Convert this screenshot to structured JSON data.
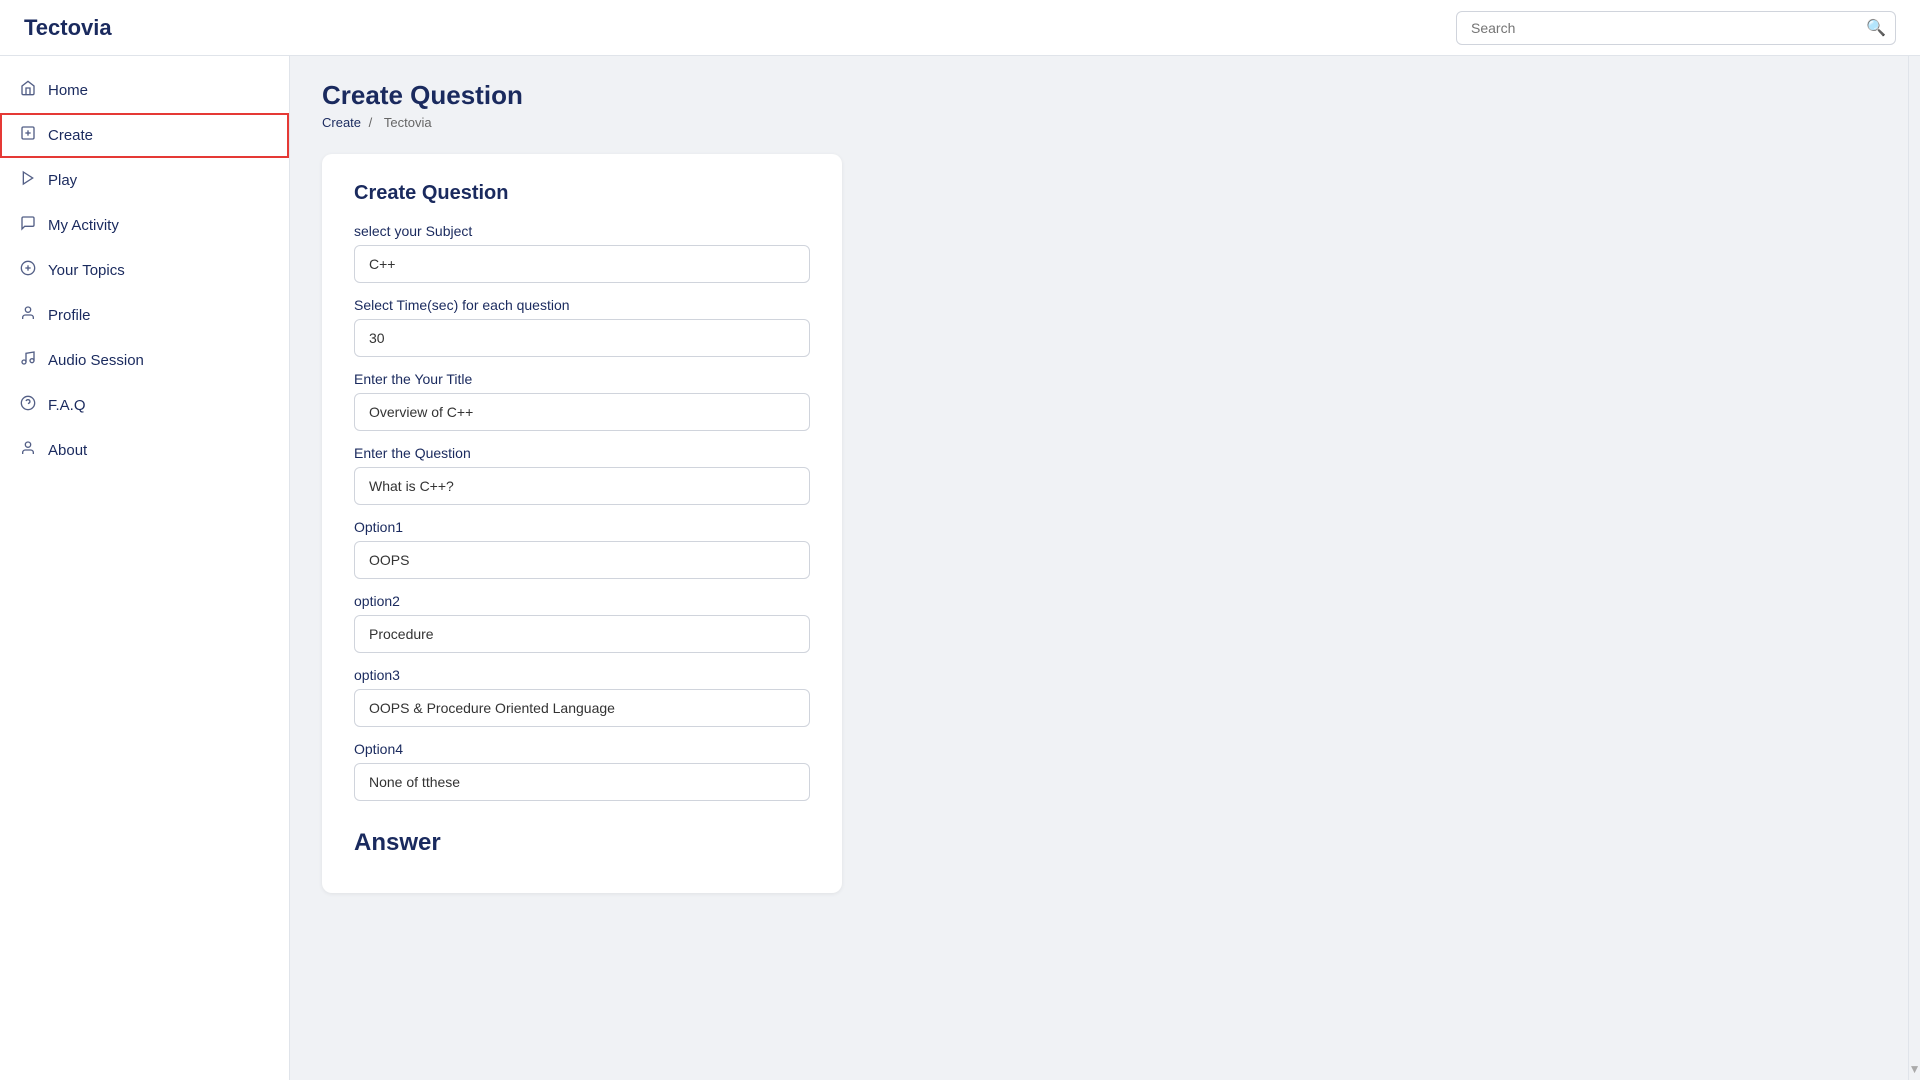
{
  "header": {
    "logo": "Tectovia",
    "search": {
      "placeholder": "Search"
    }
  },
  "sidebar": {
    "items": [
      {
        "id": "home",
        "label": "Home",
        "icon": "🏠",
        "active": false
      },
      {
        "id": "create",
        "label": "Create",
        "icon": "📋",
        "active": true
      },
      {
        "id": "play",
        "label": "Play",
        "icon": "▷",
        "active": false
      },
      {
        "id": "my-activity",
        "label": "My Activity",
        "icon": "📤",
        "active": false
      },
      {
        "id": "your-topics",
        "label": "Your Topics",
        "icon": "⊕",
        "active": false
      },
      {
        "id": "profile",
        "label": "Profile",
        "icon": "👤",
        "active": false
      },
      {
        "id": "audio-session",
        "label": "Audio Session",
        "icon": "🎧",
        "active": false
      },
      {
        "id": "faq",
        "label": "F.A.Q",
        "icon": "❓",
        "active": false
      },
      {
        "id": "about",
        "label": "About",
        "icon": "👤",
        "active": false
      }
    ]
  },
  "page": {
    "title": "Create Question",
    "breadcrumb": {
      "create": "Create",
      "separator": "/",
      "tectovia": "Tectovia"
    }
  },
  "form": {
    "card_title": "Create Question",
    "subject_label": "select your Subject",
    "subject_value": "C++",
    "time_label": "Select Time(sec) for each question",
    "time_value": "30",
    "title_label": "Enter the Your Title",
    "title_value": "Overview of C++",
    "question_label": "Enter the Question",
    "question_value": "What is C++?",
    "option1_label": "Option1",
    "option1_value": "OOPS",
    "option2_label": "option2",
    "option2_value": "Procedure",
    "option3_label": "option3",
    "option3_value": "OOPS & Procedure Oriented Language",
    "option4_label": "Option4",
    "option4_value": "None of tthese",
    "answer_title": "Answer"
  }
}
